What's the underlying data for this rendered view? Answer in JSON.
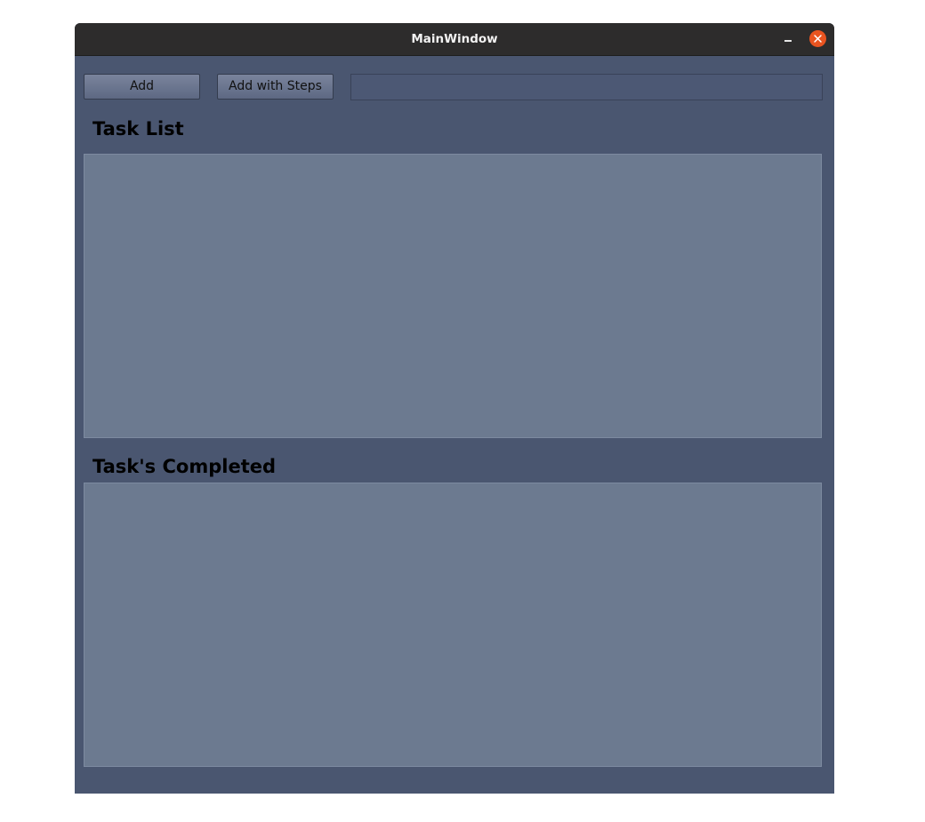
{
  "window": {
    "title": "MainWindow"
  },
  "toolbar": {
    "add_label": "Add",
    "add_steps_label": "Add with Steps",
    "task_input_value": ""
  },
  "sections": {
    "task_list_label": "Task List",
    "completed_label": "Task's Completed"
  },
  "task_list": {
    "items": []
  },
  "completed_list": {
    "items": []
  },
  "colors": {
    "titlebar": "#2d2c2c",
    "window_bg": "#4a5670",
    "list_bg": "#6c7a90",
    "close_button": "#e95420"
  },
  "icons": {
    "minimize": "minimize-icon",
    "close": "close-icon"
  }
}
